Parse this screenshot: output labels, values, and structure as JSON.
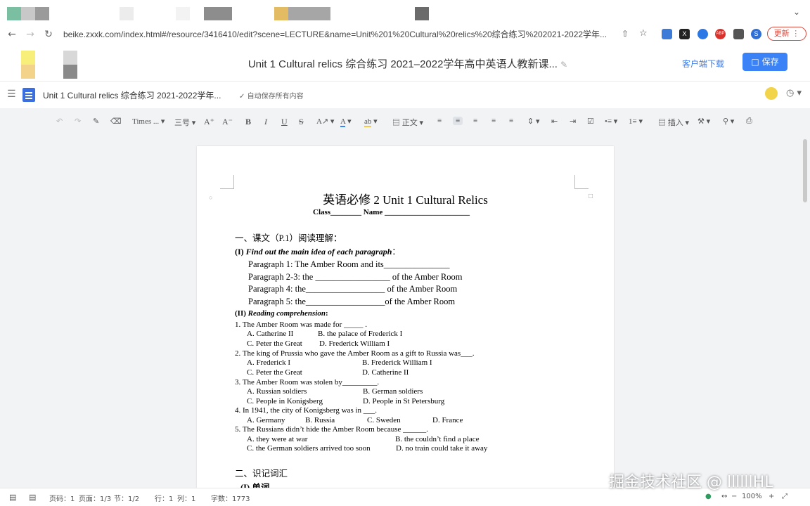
{
  "browser": {
    "url": "beike.zxxk.com/index.html#/resource/3416410/edit?scene=LECTURE&name=Unit%201%20Cultural%20relics%20综合练习%202021-2022学年...",
    "update_label": "更新",
    "ext_abp": "ABP",
    "ext_x": "X",
    "ext_s": "S"
  },
  "header": {
    "title": "Unit 1 Cultural relics 综合练习 2021–2022学年高中英语人教新课...",
    "download_label": "客户端下载",
    "save_label": "保存"
  },
  "menubar": {
    "doc_name": "Unit 1 Cultural relics 综合练习 2021-2022学年...",
    "autosave": "自动保存所有内容"
  },
  "toolbar": {
    "font": "Times ...",
    "size": "三号",
    "style": "正文",
    "insert": "插入"
  },
  "document": {
    "title": "英语必修 2    Unit 1 Cultural Relics",
    "class_line": "Class________     Name ______________________",
    "section1": "一、课文（P.1）阅读理解：",
    "part1_label": "(I) ",
    "part1_title": "Find out the main idea of each paragraph",
    "part1_colon": "：",
    "p1": "Paragraph 1: The Amber Room and its_______________",
    "p2": "Paragraph 2-3: the _________________ of the Amber Room",
    "p3": "Paragraph 4:    the__________________ of the Amber Room",
    "p4": "Paragraph 5:    the__________________of the Amber Room",
    "part2_label": "(II) ",
    "part2_title": "Reading comprehension",
    "part2_colon": ":",
    "q1": "1. The Amber Room was made for _____ .",
    "q1a": "A. Catherine II",
    "q1b": "B. the palace of Frederick I",
    "q1c": "C. Peter the Great",
    "q1d": "D. Frederick William I",
    "q2": "2. The king of Prussia who gave the Amber Room as a gift to Russia was___.",
    "q2a": "A. Frederick I",
    "q2b": "B. Frederick William I",
    "q2c": "C. Peter the Great",
    "q2d": "D. Catherine II",
    "q3": "3. The Amber Room was stolen by_________.",
    "q3a": "A. Russian soldiers",
    "q3b": "B. German soldiers",
    "q3c": "C. People in Konigsberg",
    "q3d": "D. People in St Petersburg",
    "q4": "4. In 1941, the city of Konigsberg was in ___.",
    "q4a": "A. Germany",
    "q4b": "B. Russia",
    "q4c": "C. Sweden",
    "q4d": "D. France",
    "q5": "5. The Russians didn’t hide the Amber Room because ______.",
    "q5a": "A. they were at war",
    "q5b": "B. the couldn’t find a place",
    "q5c": "C. the German soldiers arrived too soon",
    "q5d": "D. no train could take it away",
    "section2": "二、识记词汇",
    "section2_sub": "(I) 单词"
  },
  "status": {
    "page_code": "页码：1",
    "page": "页面：1/3",
    "section": "节：1/2",
    "row": "行：1",
    "col": "列：1",
    "words": "字数：1773",
    "zoom": "100%"
  },
  "watermark": "掘金技术社区 @ llllllHL",
  "colors": {
    "accent": "#3b82f6",
    "update": "#d84b3f"
  }
}
